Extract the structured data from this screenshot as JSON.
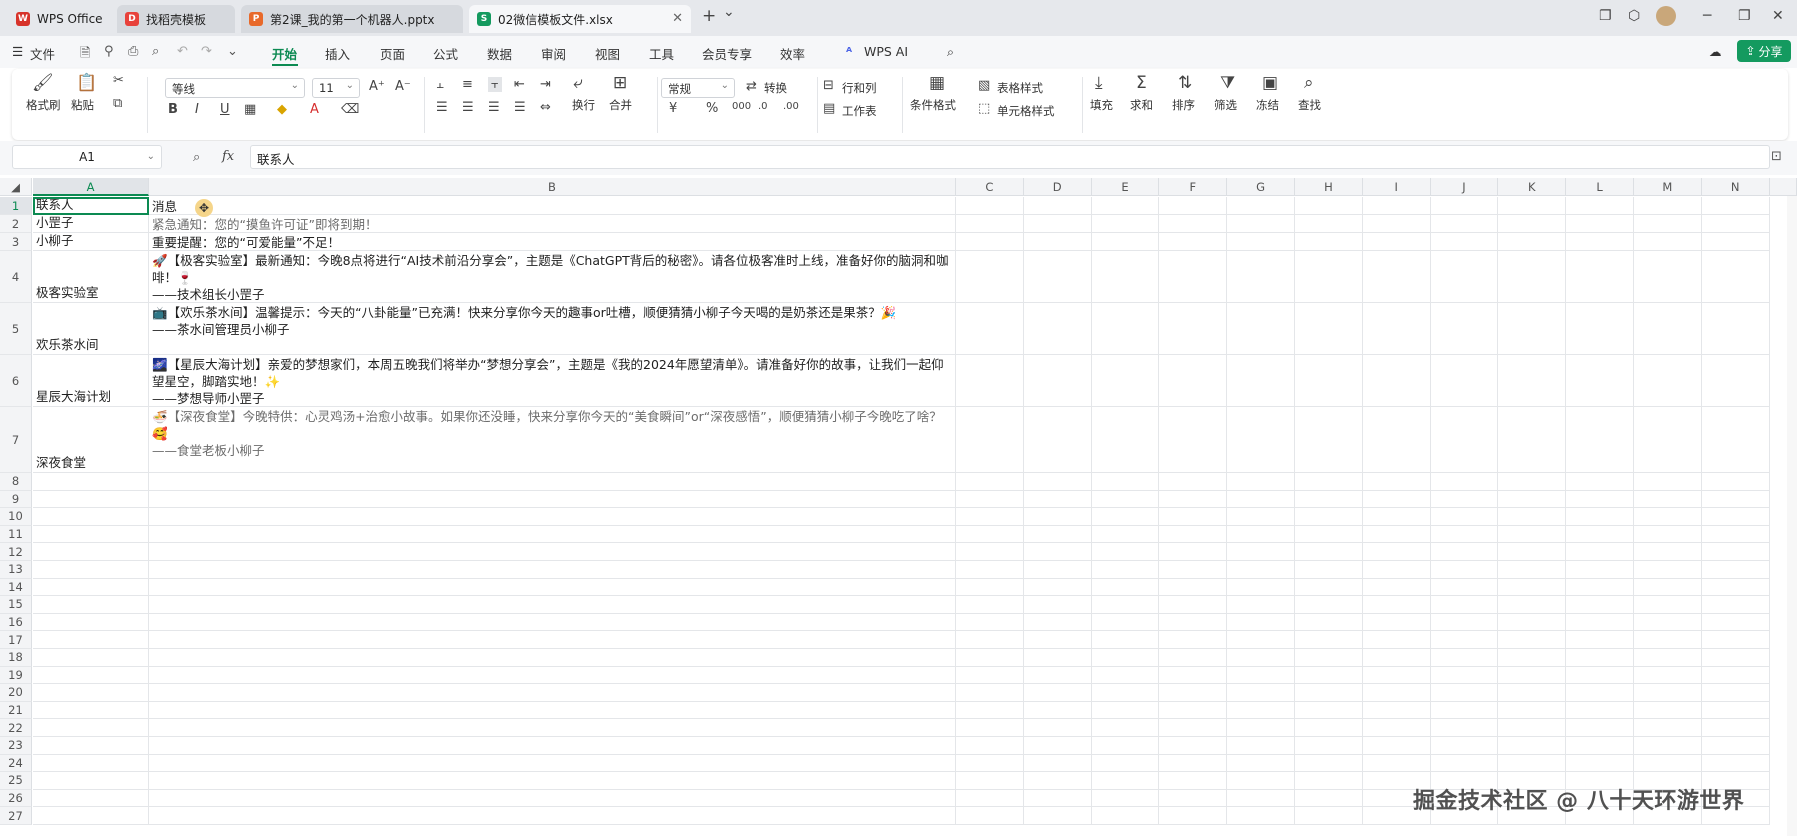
{
  "titlebar": {
    "tabs": [
      {
        "label": "WPS Office",
        "icon": "wps-logo-icon",
        "color": "#d7332a"
      },
      {
        "label": "找稻壳模板",
        "icon": "docer-icon",
        "color": "#e8423b"
      },
      {
        "label": "第2课_我的第一个机器人.pptx",
        "icon": "pptx-icon",
        "color": "#e8692a"
      },
      {
        "label": "02微信模板文件.xlsx",
        "icon": "xlsx-icon",
        "color": "#149a5f"
      }
    ],
    "new_tab": "+",
    "dropdown": "⌄"
  },
  "menubar": {
    "file_label": "文件",
    "items": [
      "开始",
      "插入",
      "页面",
      "公式",
      "数据",
      "审阅",
      "视图",
      "工具",
      "会员专享",
      "效率"
    ],
    "active": "开始",
    "wps_ai_label": "WPS AI",
    "share_label": "分享"
  },
  "ribbon": {
    "format_painter": "格式刷",
    "paste": "粘贴",
    "font_name": "等线",
    "font_size": "11",
    "number_format": "常规",
    "convert": "转换",
    "rows_cols": "行和列",
    "worksheet": "工作表",
    "wrap": "换行",
    "merge": "合并",
    "cond_format": "条件格式",
    "table_style": "表格样式",
    "cell_style": "单元格样式",
    "fill": "填充",
    "sum": "求和",
    "sort": "排序",
    "filter": "筛选",
    "freeze": "冻结",
    "find": "查找"
  },
  "formula": {
    "name_box": "A1",
    "fx": "fx",
    "content": "联系人"
  },
  "columns": [
    "A",
    "B",
    "C",
    "D",
    "E",
    "F",
    "G",
    "H",
    "I",
    "J",
    "K",
    "L",
    "M",
    "N"
  ],
  "rows": [
    {
      "num": "1",
      "a": "联系人",
      "b": "消息"
    },
    {
      "num": "2",
      "a": "小罡子",
      "b": "紧急通知：您的“摸鱼许可证”即将到期！"
    },
    {
      "num": "3",
      "a": "小柳子",
      "b": "重要提醒：您的“可爱能量”不足！"
    },
    {
      "num": "4",
      "a": "极客实验室",
      "b": "🚀【极客实验室】最新通知：今晚8点将进行“AI技术前沿分享会”，主题是《ChatGPT背后的秘密》。请各位极客准时上线，准备好你的脑洞和咖啡！🍷\n——技术组长小罡子"
    },
    {
      "num": "5",
      "a": "欢乐茶水间",
      "b": "📺【欢乐茶水间】温馨提示：今天的“八卦能量”已充满！快来分享你今天的趣事or吐槽，顺便猜猜小柳子今天喝的是奶茶还是果茶？🎉\n——茶水间管理员小柳子"
    },
    {
      "num": "6",
      "a": "星辰大海计划",
      "b": "🌌【星辰大海计划】亲爱的梦想家们，本周五晚我们将举办“梦想分享会”，主题是《我的2024年愿望清单》。请准备好你的故事，让我们一起仰望星空，脚踏实地！✨\n——梦想导师小罡子"
    },
    {
      "num": "7",
      "a": "深夜食堂",
      "b": "🍜【深夜食堂】今晚特供：心灵鸡汤+治愈小故事。如果你还没睡，快来分享你今天的“美食瞬间”or“深夜感悟”，顺便猜猜小柳子今晚吃了啥？🥰\n——食堂老板小柳子"
    },
    {
      "num": "8",
      "a": "",
      "b": ""
    },
    {
      "num": "9",
      "a": "",
      "b": ""
    },
    {
      "num": "10",
      "a": "",
      "b": ""
    },
    {
      "num": "11",
      "a": "",
      "b": ""
    },
    {
      "num": "12",
      "a": "",
      "b": ""
    },
    {
      "num": "13",
      "a": "",
      "b": ""
    },
    {
      "num": "14",
      "a": "",
      "b": ""
    },
    {
      "num": "15",
      "a": "",
      "b": ""
    },
    {
      "num": "16",
      "a": "",
      "b": ""
    },
    {
      "num": "17",
      "a": "",
      "b": ""
    },
    {
      "num": "18",
      "a": "",
      "b": ""
    },
    {
      "num": "19",
      "a": "",
      "b": ""
    },
    {
      "num": "20",
      "a": "",
      "b": ""
    },
    {
      "num": "21",
      "a": "",
      "b": ""
    },
    {
      "num": "22",
      "a": "",
      "b": ""
    },
    {
      "num": "23",
      "a": "",
      "b": ""
    },
    {
      "num": "24",
      "a": "",
      "b": ""
    },
    {
      "num": "25",
      "a": "",
      "b": ""
    },
    {
      "num": "26",
      "a": "",
      "b": ""
    },
    {
      "num": "27",
      "a": "",
      "b": ""
    }
  ],
  "watermark": "掘金技术社区 @ 八十天环游世界",
  "accent_color": "#0c8a52"
}
